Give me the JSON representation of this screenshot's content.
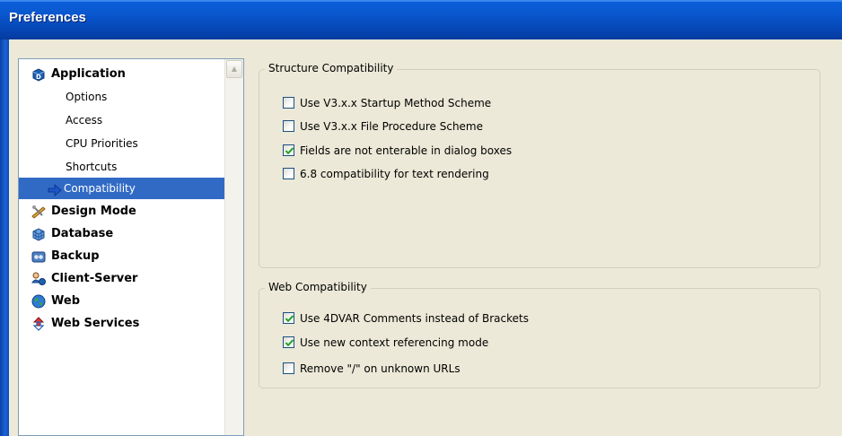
{
  "window": {
    "title": "Preferences"
  },
  "sidebar": {
    "items": [
      {
        "label": "Application",
        "type": "category",
        "icon": "application-icon"
      },
      {
        "label": "Options",
        "type": "sub"
      },
      {
        "label": "Access",
        "type": "sub"
      },
      {
        "label": "CPU Priorities",
        "type": "sub"
      },
      {
        "label": "Shortcuts",
        "type": "sub"
      },
      {
        "label": "Compatibility",
        "type": "sub",
        "selected": true,
        "icon": "arrow-right-icon"
      },
      {
        "label": "Design Mode",
        "type": "category",
        "icon": "design-mode-icon"
      },
      {
        "label": "Database",
        "type": "category",
        "icon": "database-icon"
      },
      {
        "label": "Backup",
        "type": "category",
        "icon": "backup-icon"
      },
      {
        "label": "Client-Server",
        "type": "category",
        "icon": "client-server-icon"
      },
      {
        "label": "Web",
        "type": "category",
        "icon": "web-globe-icon"
      },
      {
        "label": "Web Services",
        "type": "category",
        "icon": "web-services-icon"
      }
    ]
  },
  "structure": {
    "legend": "Structure Compatibility",
    "options": [
      {
        "label": "Use V3.x.x Startup Method Scheme",
        "checked": false
      },
      {
        "label": "Use V3.x.x File Procedure Scheme",
        "checked": false
      },
      {
        "label": "Fields are not enterable in dialog boxes",
        "checked": true
      },
      {
        "label": "6.8 compatibility for text rendering",
        "checked": false
      }
    ]
  },
  "web": {
    "legend": "Web Compatibility",
    "options": [
      {
        "label": "Use 4DVAR Comments instead of Brackets",
        "checked": true
      },
      {
        "label": "Use new context referencing mode",
        "checked": true
      },
      {
        "label": "Remove \"/\" on unknown URLs",
        "checked": false
      }
    ]
  },
  "colors": {
    "titlebar": "#0a58d0",
    "selection": "#316ac5",
    "dialog_bg": "#ece9d8",
    "check": "#21a121"
  }
}
